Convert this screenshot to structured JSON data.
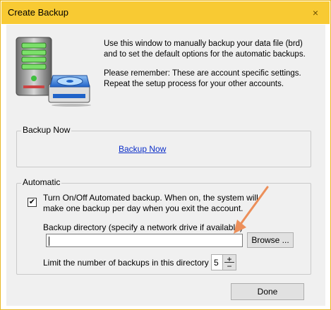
{
  "window": {
    "title": "Create Backup",
    "close_symbol": "×"
  },
  "intro": {
    "line1": "Use this window to manually backup your data file (brd) and to set the default options for the automatic backups.",
    "line2": "Please remember: These are account specific settings. Repeat the setup process for your other accounts."
  },
  "backup_now": {
    "group_label": "Backup Now",
    "link_label": "Backup Now"
  },
  "automatic": {
    "group_label": "Automatic",
    "checkbox_checked": true,
    "checkbox_mark": "✔",
    "checkbox_text": "Turn On/Off Automated backup.  When on, the system will make one backup per day when you exit the account.",
    "dir_label": "Backup directory (specify a network drive if available)",
    "dir_value": "",
    "browse_label": "Browse ...",
    "limit_label": "Limit the number of backups in this directory to",
    "limit_value": "5",
    "spin_up": "+",
    "spin_down": "−"
  },
  "done_label": "Done",
  "colors": {
    "accent": "#f8ca33",
    "link": "#0b2ec8",
    "annotation_arrow": "#ec8f5a"
  },
  "icons": {
    "header": "backup-server-icon",
    "annotation": "annotation-arrow-icon"
  }
}
